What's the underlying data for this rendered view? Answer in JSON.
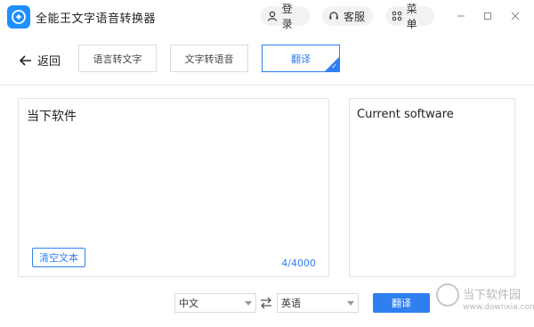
{
  "app": {
    "title": "全能王文字语音转换器",
    "logo_icon": "app-logo-icon",
    "brand_color": "#1e8fff"
  },
  "header": {
    "login_label": "登录",
    "service_label": "客服",
    "menu_label": "菜单",
    "login_icon": "user-icon",
    "service_icon": "headset-icon",
    "menu_icon": "grid-icon"
  },
  "window_controls": {
    "minimize_icon": "minimize-icon",
    "maximize_icon": "maximize-icon",
    "close_icon": "close-icon"
  },
  "toolbar": {
    "back_label": "返回",
    "tabs": [
      {
        "label": "语言转文字",
        "active": false
      },
      {
        "label": "文字转语音",
        "active": false
      },
      {
        "label": "翻译",
        "active": true
      }
    ],
    "accent_color": "#2f7ff0"
  },
  "source": {
    "text": "当下软件",
    "clear_label": "清空文本",
    "char_count": "4/4000"
  },
  "target": {
    "text": "Current software"
  },
  "controls": {
    "source_lang": "中文",
    "target_lang": "英语",
    "translate_label": "翻译",
    "swap_icon": "swap-icon"
  },
  "watermark": {
    "text": "当下软件园",
    "url": "www.downxia.com"
  }
}
